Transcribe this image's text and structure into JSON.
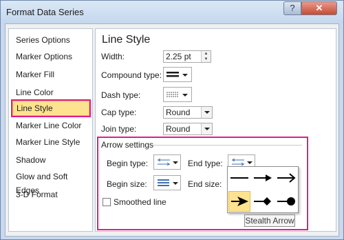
{
  "window": {
    "title": "Format Data Series",
    "help_label": "?",
    "close_label": "✕"
  },
  "nav": {
    "items": [
      {
        "label": "Series Options"
      },
      {
        "label": "Marker Options"
      },
      {
        "label": "Marker Fill"
      },
      {
        "label": "Line Color"
      },
      {
        "label": "Line Style",
        "selected": true
      },
      {
        "label": "Marker Line Color"
      },
      {
        "label": "Marker Line Style"
      },
      {
        "label": "Shadow"
      },
      {
        "label": "Glow and Soft Edges"
      },
      {
        "label": "3-D Format"
      }
    ]
  },
  "panel": {
    "heading": "Line Style",
    "width": {
      "label": "Width:",
      "value": "2.25 pt"
    },
    "compound_type": {
      "label": "Compound type:"
    },
    "dash_type": {
      "label": "Dash type:"
    },
    "cap_type": {
      "label": "Cap type:",
      "value": "Round"
    },
    "join_type": {
      "label": "Join type:",
      "value": "Round"
    },
    "arrow_settings": {
      "title": "Arrow settings",
      "begin_type": {
        "label": "Begin type:"
      },
      "end_type": {
        "label": "End type:"
      },
      "begin_size": {
        "label": "Begin size:"
      },
      "end_size": {
        "label": "End size:"
      },
      "smoothed_line": {
        "label": "Smoothed line",
        "checked": false
      }
    }
  },
  "gallery": {
    "icons": [
      "no-arrow-line-icon",
      "arrow-icon",
      "open-arrow-icon",
      "stealth-arrow-icon",
      "diamond-arrow-icon",
      "oval-arrow-icon"
    ],
    "selected": "stealth-arrow-icon",
    "tooltip": "Stealth Arrow"
  },
  "colors": {
    "highlight": "#e01b8c",
    "selection": "#fde38f"
  }
}
